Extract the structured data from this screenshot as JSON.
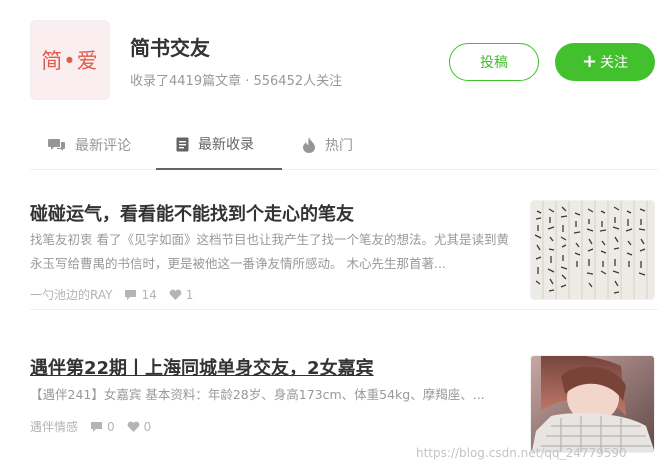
{
  "collection": {
    "logo_text": "简•爱",
    "title": "简书交友",
    "meta": "收录了4419篇文章 · 556452人关注",
    "contribute_label": "投稿",
    "follow_label": "关注",
    "follow_icon": "plus-icon"
  },
  "tabs": [
    {
      "label": "最新评论",
      "icon": "comments-icon",
      "active": false
    },
    {
      "label": "最新收录",
      "icon": "document-icon",
      "active": true
    },
    {
      "label": "热门",
      "icon": "fire-icon",
      "active": false
    }
  ],
  "articles": [
    {
      "title": "碰碰运气，看看能不能找到个走心的笔友",
      "abstract": "找笔友初衷 看了《见字如面》这档节目也让我产生了找一个笔友的想法。尤其是读到黄永玉写给曹禺的书信时，更是被他这一番诤友情所感动。 木心先生那首著...",
      "author": "一勺池边的RAY",
      "comments": "14",
      "likes": "1",
      "thumbnail": "handwritten-letter-image"
    },
    {
      "title": "遇伴第22期丨上海同城单身交友，2女嘉宾",
      "abstract": "【遇伴241】女嘉宾 基本资料：年龄28岁、身高173cm、体重54kg、摩羯座、...",
      "author": "遇伴情感",
      "comments": "0",
      "likes": "0",
      "thumbnail": "woman-portrait-image"
    }
  ],
  "watermark": "https://blog.csdn.net/qq_24779590",
  "colors": {
    "accent": "#42c02e",
    "logo_bg": "#fbeef0",
    "logo_text": "#e05b4b",
    "muted": "#999999"
  }
}
